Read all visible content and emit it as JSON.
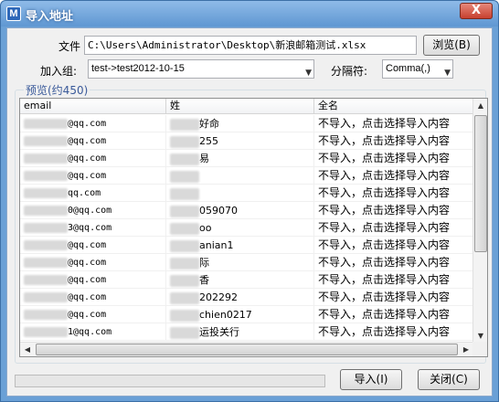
{
  "window": {
    "title": "导入地址",
    "icon": "app-icon",
    "close_label": "X"
  },
  "file": {
    "label": "文件",
    "value": "C:\\Users\\Administrator\\Desktop\\新浪邮箱测试.xlsx",
    "browse_label": "浏览(B)"
  },
  "group": {
    "label": "加入组:",
    "value": "test->test2012-10-15"
  },
  "separator": {
    "label": "分隔符:",
    "value": "Comma(,)"
  },
  "preview": {
    "label": "预览(约450)",
    "columns": [
      "email",
      "姓",
      "全名"
    ],
    "rows": [
      {
        "email": "@qq.com",
        "name": "好命",
        "full": "不导入，点击选择导入内容"
      },
      {
        "email": "@qq.com",
        "name": "255",
        "full": "不导入，点击选择导入内容"
      },
      {
        "email": "@qq.com",
        "name": "易",
        "full": "不导入，点击选择导入内容"
      },
      {
        "email": "@qq.com",
        "name": "",
        "full": "不导入，点击选择导入内容"
      },
      {
        "email": "qq.com",
        "name": "",
        "full": "不导入，点击选择导入内容"
      },
      {
        "email": "0@qq.com",
        "name": "059070",
        "full": "不导入，点击选择导入内容"
      },
      {
        "email": "3@qq.com",
        "name": "oo",
        "full": "不导入，点击选择导入内容"
      },
      {
        "email": "@qq.com",
        "name": "anian1",
        "full": "不导入，点击选择导入内容"
      },
      {
        "email": "@qq.com",
        "name": "际",
        "full": "不导入，点击选择导入内容"
      },
      {
        "email": "@qq.com",
        "name": "香",
        "full": "不导入，点击选择导入内容"
      },
      {
        "email": "@qq.com",
        "name": "202292",
        "full": "不导入，点击选择导入内容"
      },
      {
        "email": "@qq.com",
        "name": "chien0217",
        "full": "不导入，点击选择导入内容"
      },
      {
        "email": "1@qq.com",
        "name": "运投关行",
        "full": "不导入，点击选择导入内容"
      },
      {
        "email": "",
        "name": "",
        "full": "不导入，点击选择导入内容"
      }
    ]
  },
  "actions": {
    "import_label": "导入(I)",
    "close_label": "关闭(C)"
  },
  "colors": {
    "titlebar": "#6aa0d6",
    "client": "#f0f0f0",
    "group_title": "#3a5a9a"
  },
  "icons": {
    "combo_arrow": "chevron-down-icon",
    "scroll_up": "scroll-up-icon",
    "scroll_down": "scroll-down-icon"
  }
}
